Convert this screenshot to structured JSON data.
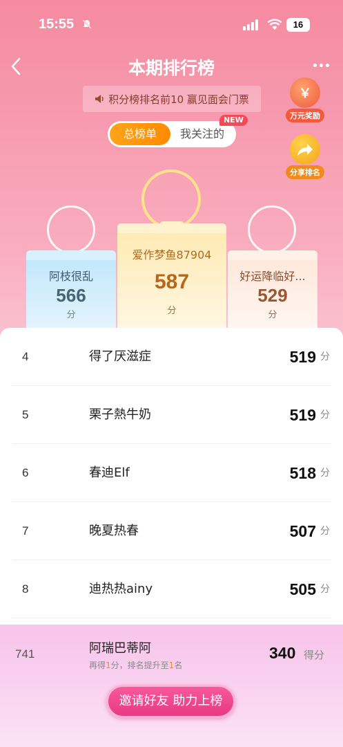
{
  "status_bar": {
    "time": "15:55",
    "battery": "16"
  },
  "header": {
    "title": "本期排行榜",
    "announcement": "积分榜排名前10 赢见面会门票"
  },
  "side_buttons": {
    "reward_label": "万元奖励",
    "share_label": "分享排名"
  },
  "tabs": [
    {
      "label": "总榜单",
      "active": true
    },
    {
      "label": "我关注的",
      "active": false,
      "badge": "NEW"
    }
  ],
  "podium": {
    "first": {
      "name": "爱作梦鱼87904",
      "score": "587",
      "unit": "分"
    },
    "second": {
      "name": "阿枝很乱",
      "score": "566",
      "unit": "分"
    },
    "third": {
      "name": "好运降临好...",
      "score": "529",
      "unit": "分"
    }
  },
  "ranking": [
    {
      "rank": "4",
      "name": "得了厌滋症",
      "score": "519",
      "unit": "分"
    },
    {
      "rank": "5",
      "name": "栗子熱牛奶",
      "score": "519",
      "unit": "分"
    },
    {
      "rank": "6",
      "name": "春迪Elf",
      "score": "518",
      "unit": "分"
    },
    {
      "rank": "7",
      "name": "晚夏热春",
      "score": "507",
      "unit": "分"
    },
    {
      "rank": "8",
      "name": "迪热热ainy",
      "score": "505",
      "unit": "分"
    }
  ],
  "my_rank": {
    "rank": "741",
    "name": "阿瑞巴蒂阿",
    "hint_prefix": "再得",
    "hint_points": "1",
    "hint_mid": "分，排名提升至",
    "hint_rank": "1",
    "hint_suffix": "名",
    "score": "340",
    "unit": "得分"
  },
  "invite_button": "邀请好友 助力上榜",
  "colors": {
    "accent_orange": "#ff9a0a",
    "invite_pink": "#ee4690",
    "header_pink": "#f58aa0"
  }
}
